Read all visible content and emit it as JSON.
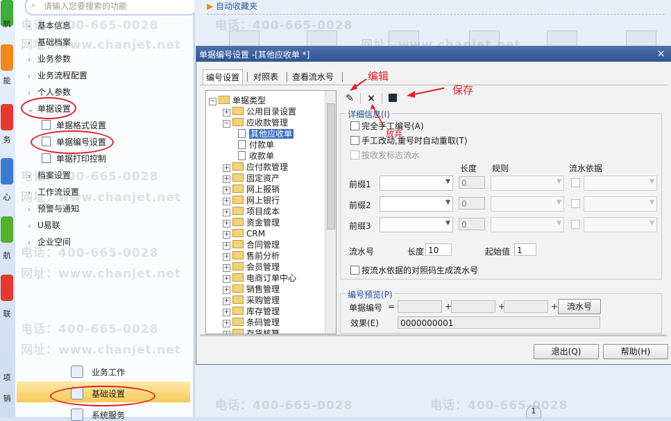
{
  "rail": {
    "labels": [
      "航",
      "能",
      "务",
      "心",
      "航",
      "联",
      "项",
      "销"
    ]
  },
  "nav": {
    "search_placeholder": "请输入您要搜索的功能",
    "items": [
      {
        "label": "基本信息"
      },
      {
        "label": "基础档案"
      },
      {
        "label": "业务参数"
      },
      {
        "label": "业务流程配置"
      },
      {
        "label": "个人参数"
      },
      {
        "label": "单据设置"
      },
      {
        "label": "档案设置"
      },
      {
        "label": "工作流设置"
      },
      {
        "label": "预警与通知"
      },
      {
        "label": "U易联"
      },
      {
        "label": "企业空间"
      }
    ],
    "sub_items": [
      {
        "label": "单据格式设置"
      },
      {
        "label": "单据编号设置"
      },
      {
        "label": "单据打印控制"
      }
    ],
    "bottom": [
      {
        "label": "业务工作"
      },
      {
        "label": "基础设置"
      },
      {
        "label": "系统服务"
      }
    ]
  },
  "workspace": {
    "favorites": "自动收藏夹",
    "page_indicator": "1"
  },
  "watermark": {
    "phone": "电话：400-665-0028",
    "site": "网址：www.chanjet.net"
  },
  "dialog": {
    "title": "单据编号设置 -[其他应收单 *]",
    "close": "×",
    "tabs": [
      "编号设置",
      "对照表",
      "查看流水号"
    ],
    "tree": {
      "root": "单据类型",
      "nodes": [
        "公用目录设置",
        "应收款管理",
        "其他应收单",
        "付款单",
        "收款单",
        "应付款管理",
        "固定资产",
        "网上报销",
        "网上银行",
        "项目成本",
        "资金管理",
        "CRM",
        "合同管理",
        "售前分析",
        "会员管理",
        "电商订单中心",
        "销售管理",
        "采购管理",
        "库存管理",
        "条码管理",
        "存货核算"
      ]
    },
    "toolbar": {
      "edit": "编辑",
      "cancel": "×",
      "save": "保存"
    },
    "detail": {
      "title": "详细信息(I)",
      "manual": "完全手工编号(A)",
      "manual_redo": "手工改动,重号时自动重取(T)",
      "by_flag": "按收发标志流水",
      "col_length": "长度",
      "col_rule": "规则",
      "col_flow_basis": "流水依据",
      "prefixes": [
        {
          "label": "前缀1",
          "length": "0"
        },
        {
          "label": "前缀2",
          "length": "0"
        },
        {
          "label": "前缀3",
          "length": "0"
        }
      ],
      "serial_label": "流水号",
      "serial_length_label": "长度",
      "serial_length": "10",
      "start_label": "起始值",
      "start_value": "1",
      "gen_by_code": "按流水依据的对照码生成流水号"
    },
    "preview": {
      "title": "编号预览(P)",
      "number_label": "单据编号",
      "eq": "=",
      "plus": "+",
      "serial": "流水号",
      "effect_label": "效果(E)",
      "effect_value": "0000000001"
    },
    "buttons": {
      "exit": "退出(Q)",
      "help": "帮助(H)"
    }
  },
  "annotations": {
    "edit": "编辑",
    "save": "保存",
    "give_up": "放弃"
  },
  "colors": {
    "accent": "#3b6fc2",
    "annotation": "#e0202a",
    "title_bar": "#2e5493"
  }
}
